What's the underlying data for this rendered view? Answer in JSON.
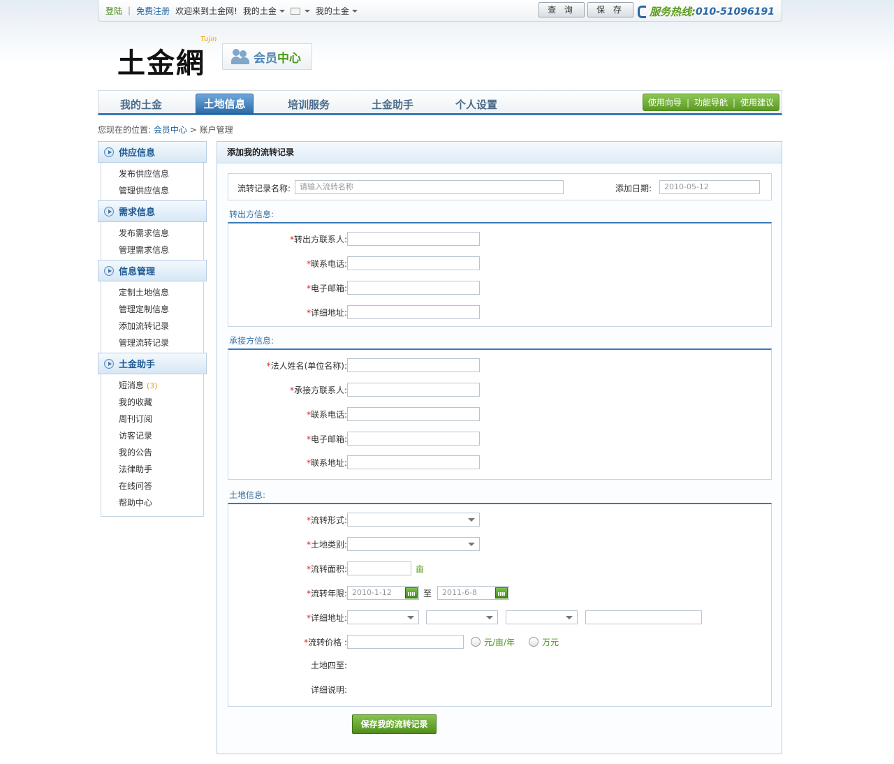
{
  "topbar": {
    "login": "登陆",
    "register": "免费注册",
    "welcome": "欢迎来到土金网!",
    "my_tujin_1": "我的土金",
    "my_tujin_2": "我的土金",
    "query_btn": "查 询",
    "save_btn": "保 存",
    "hotline_label": "服务热线:",
    "hotline_number": "010-51096191"
  },
  "logo": {
    "text": "土金網",
    "sub": "Tujin"
  },
  "member_center": {
    "part1": "会员",
    "part2": "中心"
  },
  "nav": {
    "items": [
      "我的土金",
      "土地信息",
      "培训服务",
      "土金助手",
      "个人设置"
    ],
    "active": "土地信息",
    "quick_links": [
      "使用向导",
      "功能导航",
      "使用建议"
    ]
  },
  "breadcrumb": {
    "prefix": "您现在的位置:",
    "home": "会员中心",
    "arrow": ">",
    "current": "账户管理"
  },
  "sidebar": {
    "groups": [
      {
        "title": "供应信息",
        "items": [
          "发布供应信息",
          "管理供应信息"
        ]
      },
      {
        "title": "需求信息",
        "items": [
          "发布需求信息",
          "管理需求信息"
        ]
      },
      {
        "title": "信息管理",
        "items": [
          "定制土地信息",
          "管理定制信息",
          "添加流转记录",
          "管理流转记录"
        ]
      },
      {
        "title": "土金助手",
        "items": [
          "短消息",
          "我的收藏",
          "周刊订阅",
          "访客记录",
          "我的公告",
          "法律助手",
          "在线问答",
          "帮助中心"
        ]
      }
    ],
    "message_count": "(3)"
  },
  "main": {
    "title": "添加我的流转记录",
    "record_name_label": "流转记录名称:",
    "record_name_placeholder": "请输入流转名称",
    "add_date_label": "添加日期:",
    "add_date_value": "2010-05-12",
    "transferor": {
      "title": "转出方信息:",
      "fields": [
        "转出方联系人:",
        "联系电话:",
        "电子邮箱:",
        "详细地址:"
      ]
    },
    "transferee": {
      "title": "承接方信息:",
      "fields": [
        "法人姓名(单位名称):",
        "承接方联系人:",
        "联系电话:",
        "电子邮箱:",
        "联系地址:"
      ]
    },
    "land": {
      "title": "土地信息:",
      "form_label": "流转形式:",
      "type_label": "土地类别:",
      "area_label": "流转面积:",
      "area_unit": "亩",
      "term_label": "流转年限:",
      "term_start": "2010-1-12",
      "term_to": "至",
      "term_end": "2011-6-8",
      "address_label": "详细地址:",
      "price_label": "流转价格 :",
      "price_unit1": "元/亩/年",
      "price_unit2": "万元",
      "boundary_label": "土地四至:",
      "desc_label": "详细说明:"
    },
    "submit": "保存我的流转记录"
  },
  "colors": {
    "accent_blue": "#3b78b5",
    "accent_green": "#5d9a25",
    "required": "#dd2222"
  }
}
